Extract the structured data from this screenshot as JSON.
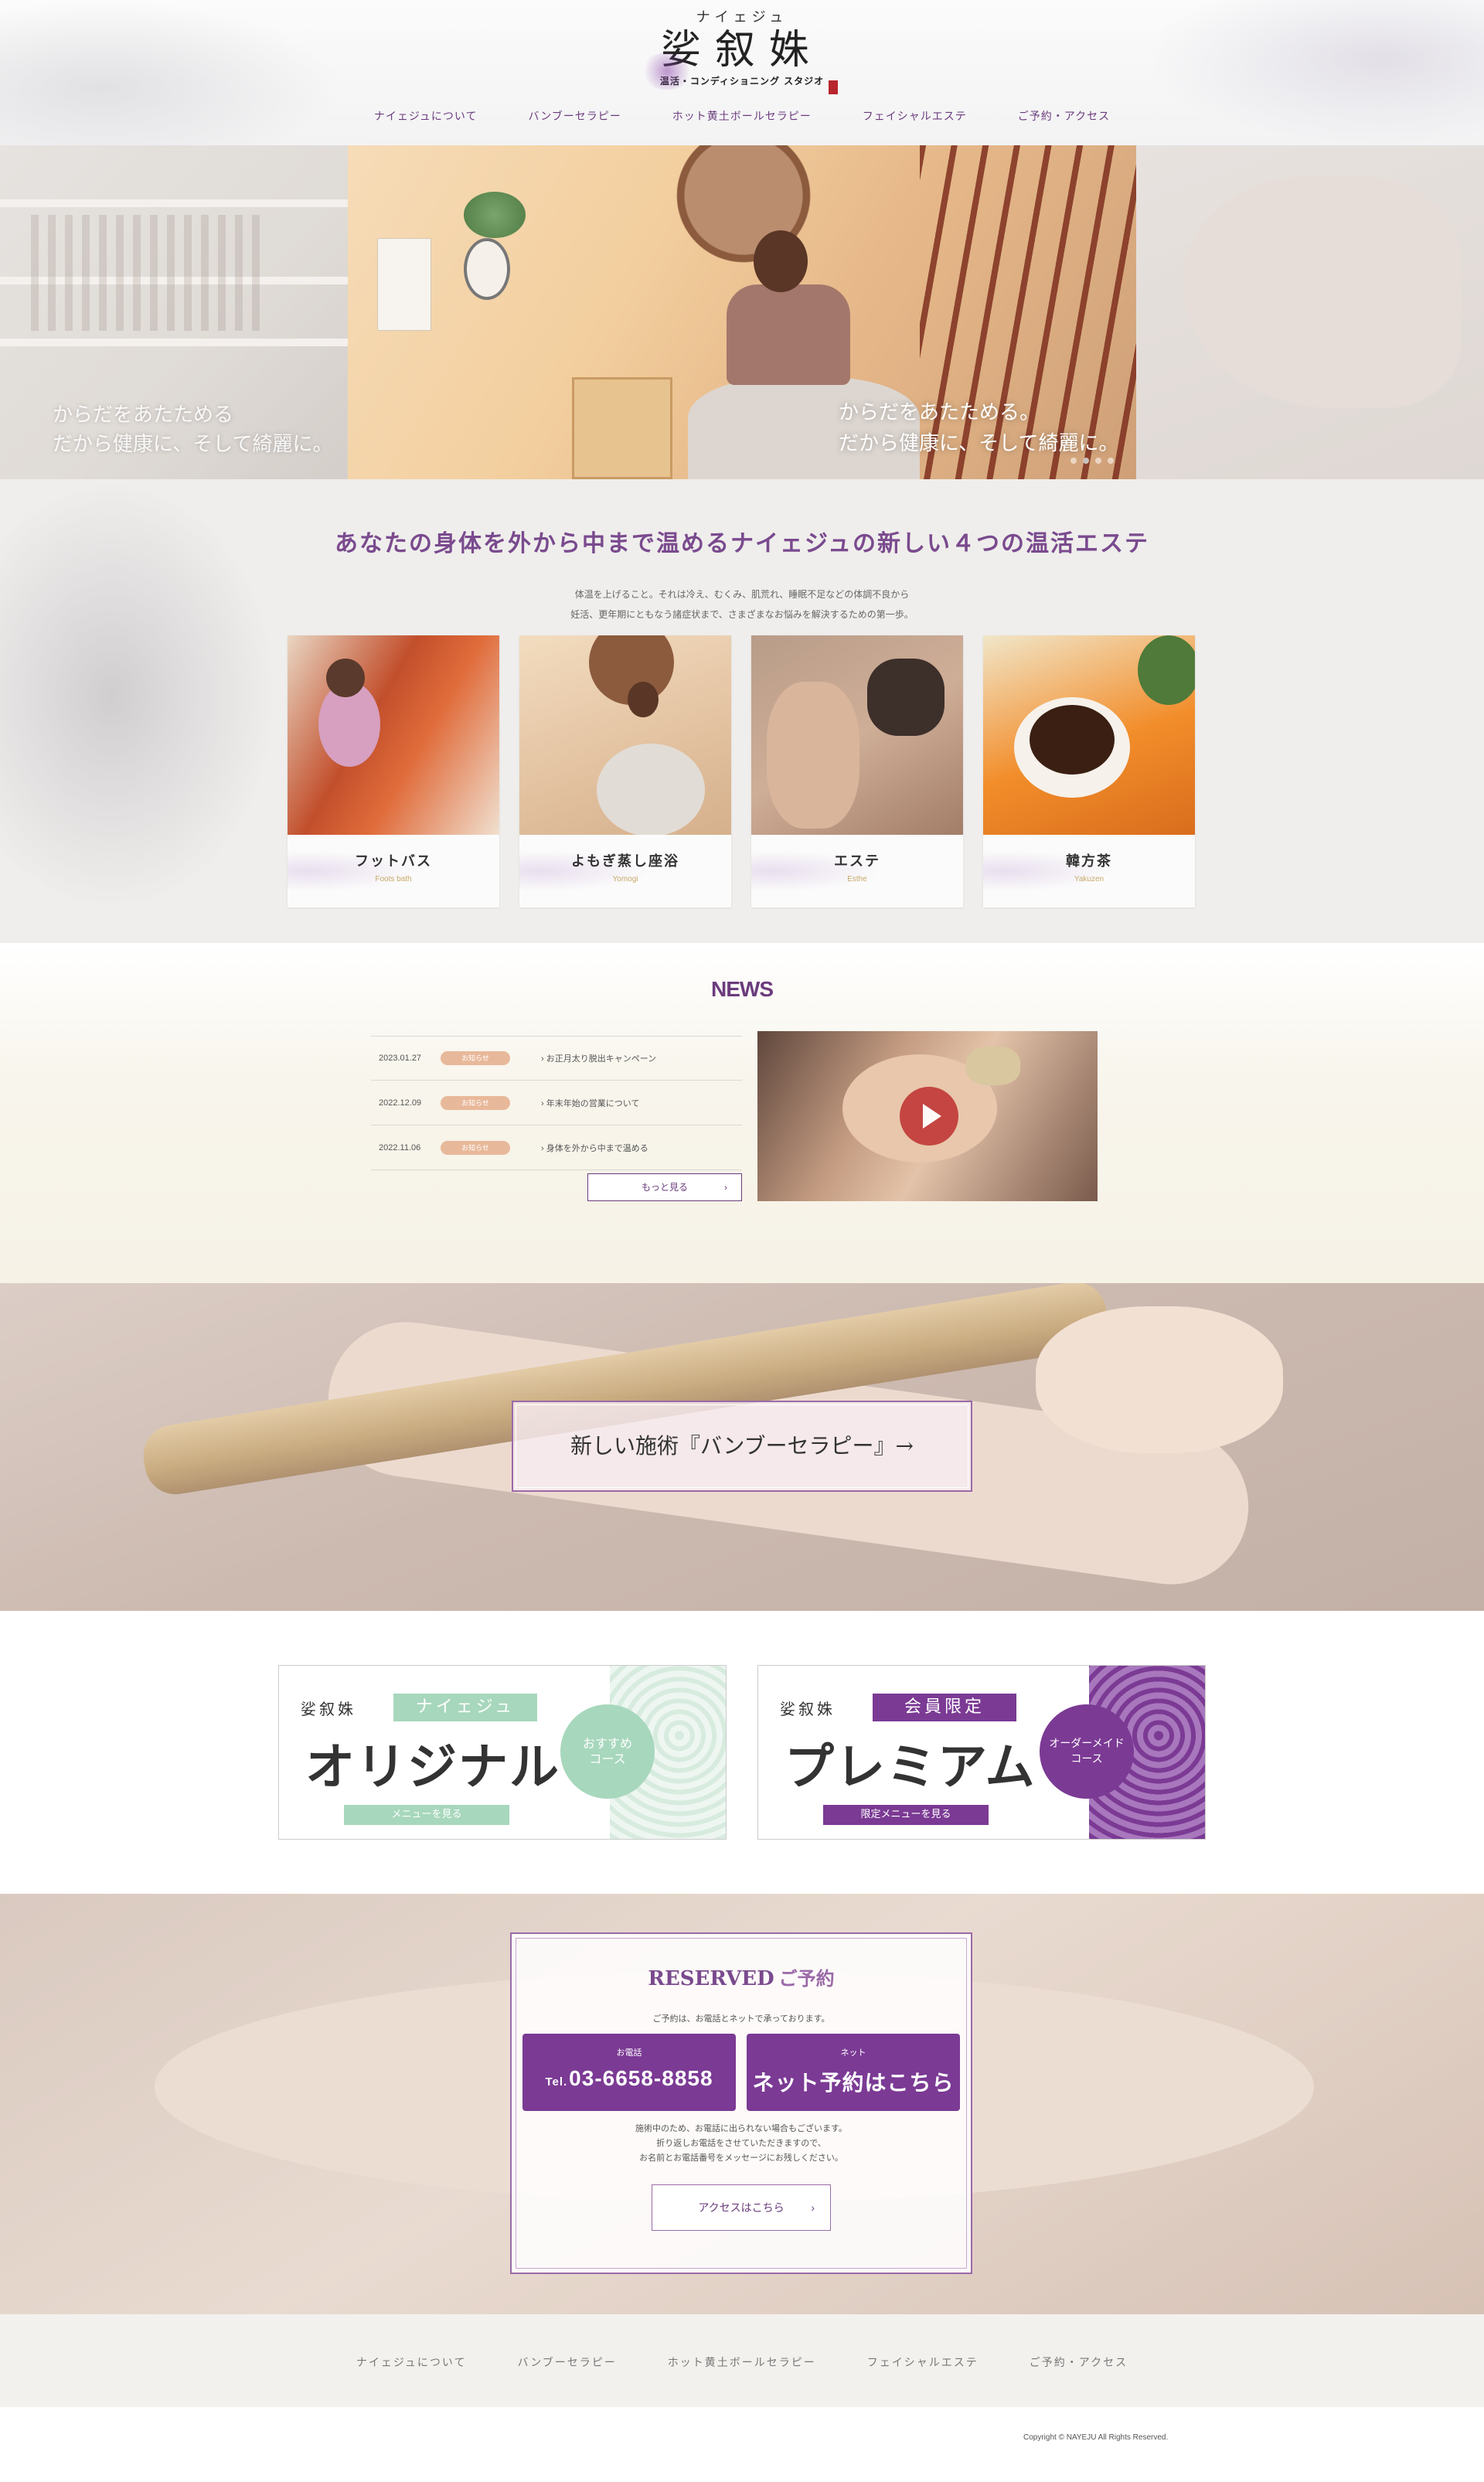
{
  "header": {
    "logo_kana": "ナイェジュ",
    "logo_main": "娑叙姝",
    "logo_sub": "温活・コンディショニング スタジオ",
    "nav": [
      "ナイェジュについて",
      "バンブーセラピー",
      "ホット黄土ボールセラピー",
      "フェイシャルエステ",
      "ご予約・アクセス"
    ]
  },
  "hero": {
    "caption_line1": "からだをあたためる。",
    "caption_line2": "だから健康に、そして綺麗に。",
    "side_caption_line1": "からだをあたためる",
    "side_caption_line2": "だから健康に、そして綺麗に。",
    "slide_count": 4,
    "active_slide": 1
  },
  "intro": {
    "title": "あなたの身体を外から中まで温めるナイェジュの新しい４つの温活エステ",
    "text_line1": "体温を上げること。それは冷え、むくみ、肌荒れ、睡眠不足などの体調不良から",
    "text_line2": "妊活、更年期にともなう諸症状まで、さまざまなお悩みを解決するための第一歩。",
    "cards": [
      {
        "title": "フットバス",
        "sub": "Foots bath"
      },
      {
        "title": "よもぎ蒸し座浴",
        "sub": "Yomogi"
      },
      {
        "title": "エステ",
        "sub": "Esthe"
      },
      {
        "title": "韓方茶",
        "sub": "Yakuzen"
      }
    ]
  },
  "news": {
    "title": "NEWS",
    "items": [
      {
        "date": "2023.01.27",
        "tag": "お知らせ",
        "text": "お正月太り脱出キャンペーン"
      },
      {
        "date": "2022.12.09",
        "tag": "お知らせ",
        "text": "年末年始の営業について"
      },
      {
        "date": "2022.11.06",
        "tag": "お知らせ",
        "text": "身体を外から中まで温める"
      }
    ],
    "more_label": "もっと見る",
    "more_arrow": "›"
  },
  "bamboo": {
    "label": "新しい施術『バンブーセラピー』→"
  },
  "banners": {
    "original": {
      "logo": "娑叙姝",
      "tag": "ナイェジュ",
      "main": "オリジナル",
      "circle_line1": "おすすめ",
      "circle_line2": "コース",
      "button": "メニューを見る"
    },
    "premium": {
      "logo": "娑叙姝",
      "tag": "会員限定",
      "main": "プレミアム",
      "circle_line1": "オーダーメイド",
      "circle_line2": "コース",
      "button": "限定メニューを見る"
    }
  },
  "reserve": {
    "title_en": "RESERVED",
    "title_jp": "ご予約",
    "lead": "ご予約は、お電話とネットで承っております。",
    "tel_small": "お電話",
    "tel_prefix": "Tel.",
    "tel_number": "03-6658-8858",
    "net_small": "ネット",
    "net_label": "ネット予約はこちら",
    "note_line1": "施術中のため、お電話に出られない場合もございます。",
    "note_line2": "折り返しお電話をさせていただきますので、",
    "note_line3": "お名前とお電話番号をメッセージにお残しください。",
    "access_label": "アクセスはこちら",
    "access_arrow": "›"
  },
  "footer": {
    "nav": [
      "ナイェジュについて",
      "バンブーセラピー",
      "ホット黄土ボールセラピー",
      "フェイシャルエステ",
      "ご予約・アクセス"
    ],
    "copyright": "Copyright © NAYEJU All Rights Reserved."
  },
  "colors": {
    "accent": "#7b3a94",
    "accent_text": "#6b3c7d",
    "mint": "#a7d7bd",
    "tag": "#e8b89a",
    "play": "#c23a38"
  },
  "icons": [
    "play-icon",
    "arrow-right-icon",
    "chevron-right-icon"
  ]
}
